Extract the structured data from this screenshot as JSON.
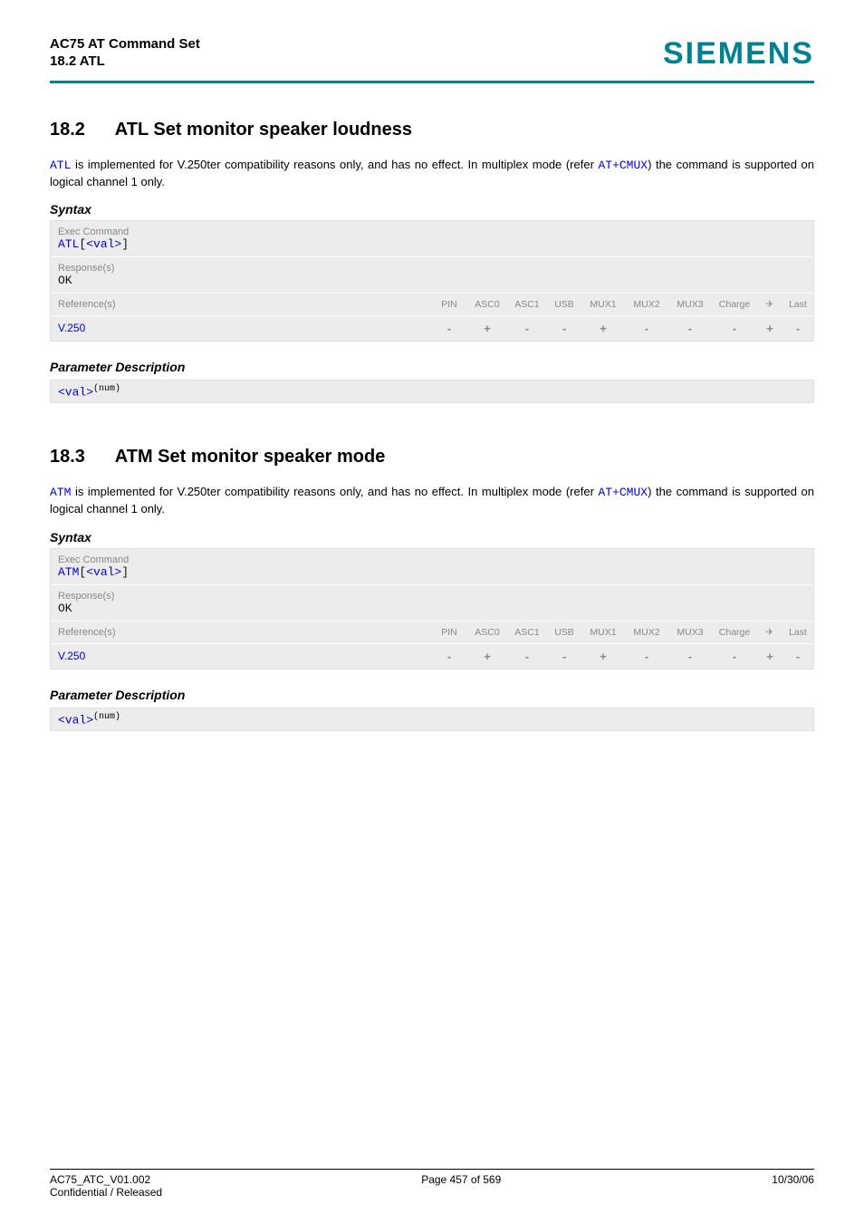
{
  "header": {
    "title": "AC75 AT Command Set",
    "sub": "18.2 ATL",
    "brand": "SIEMENS"
  },
  "sections": [
    {
      "num": "18.2",
      "title": "ATL   Set monitor speaker loudness",
      "intro_cmd": "ATL",
      "intro_text_mid": " is implemented for V.250ter compatibility reasons only, and has no effect. In multiplex mode (refer ",
      "intro_cmd2": "AT+CMUX",
      "intro_text_tail": ") the command is supported on logical channel 1 only.",
      "syntax_label": "Syntax",
      "box": {
        "exec_label": "Exec Command",
        "cmd_kw": "ATL",
        "cmd_open": "[",
        "cmd_arg": "<val>",
        "cmd_close": "]",
        "resp_label": "Response(s)",
        "resp_val": "OK",
        "ref_label": "Reference(s)",
        "ref_val": "V.250",
        "cols": [
          "PIN",
          "ASC0",
          "ASC1",
          "USB",
          "MUX1",
          "MUX2",
          "MUX3",
          "Charge",
          "✈",
          "Last"
        ],
        "vals": [
          "-",
          "+",
          "-",
          "-",
          "+",
          "-",
          "-",
          "-",
          "+",
          "-"
        ]
      },
      "param_label": "Parameter Description",
      "param_name": "<val>",
      "param_type": "(num)"
    },
    {
      "num": "18.3",
      "title": "ATM   Set monitor speaker mode",
      "intro_cmd": "ATM",
      "intro_text_mid": " is implemented for V.250ter compatibility reasons only, and has no effect. In multiplex mode (refer ",
      "intro_cmd2": "AT+CMUX",
      "intro_text_tail": ") the command is supported on logical channel 1 only.",
      "syntax_label": "Syntax",
      "box": {
        "exec_label": "Exec Command",
        "cmd_kw": "ATM",
        "cmd_open": "[",
        "cmd_arg": "<val>",
        "cmd_close": "]",
        "resp_label": "Response(s)",
        "resp_val": "OK",
        "ref_label": "Reference(s)",
        "ref_val": "V.250",
        "cols": [
          "PIN",
          "ASC0",
          "ASC1",
          "USB",
          "MUX1",
          "MUX2",
          "MUX3",
          "Charge",
          "✈",
          "Last"
        ],
        "vals": [
          "-",
          "+",
          "-",
          "-",
          "+",
          "-",
          "-",
          "-",
          "+",
          "-"
        ]
      },
      "param_label": "Parameter Description",
      "param_name": "<val>",
      "param_type": "(num)"
    }
  ],
  "footer": {
    "left": "AC75_ATC_V01.002",
    "center": "Page 457 of 569",
    "right": "10/30/06",
    "left2": "Confidential / Released"
  }
}
